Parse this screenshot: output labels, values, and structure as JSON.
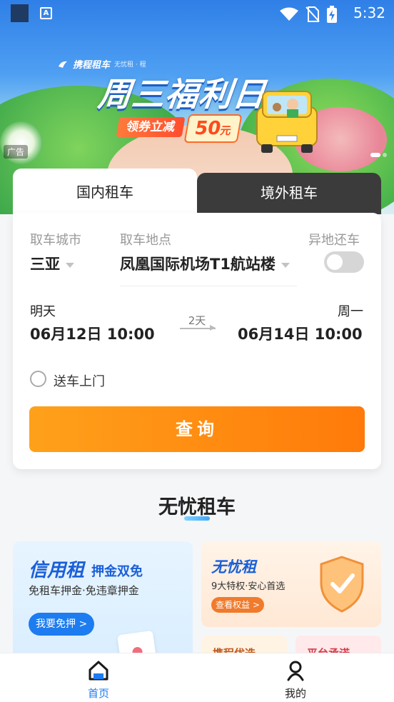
{
  "status_bar": {
    "time": "5:32",
    "icons": [
      "app-square-icon",
      "accessibility-a-icon",
      "wifi-icon",
      "no-sim-icon",
      "battery-charging-icon"
    ],
    "a_glyph": "A"
  },
  "banner": {
    "brand": "携程租车",
    "brand_partner": "无忧租 · 程",
    "title": "周三福利日",
    "ribbon_left": "领券立减",
    "ribbon_amount": "50",
    "ribbon_unit": "元",
    "ad_tag": "广告"
  },
  "tabs": {
    "domestic": "国内租车",
    "overseas": "境外租车"
  },
  "form": {
    "pickup_city_label": "取车城市",
    "pickup_city": "三亚",
    "pickup_location_label": "取车地点",
    "pickup_location": "凤凰国际机场T1航站楼",
    "diff_return_label": "异地还车",
    "diff_return_on": false,
    "start_day": "明天",
    "start_datetime": "06月12日 10:00",
    "duration": "2天",
    "end_day": "周一",
    "end_datetime": "06月14日 10:00",
    "delivery_label": "送车上门",
    "query_label": "查询"
  },
  "section": {
    "title": "无忧租车"
  },
  "promo_left": {
    "title": "信用租",
    "highlight": "押金双免",
    "subtitle": "免租车押金·免违章押金",
    "button": "我要免押 >"
  },
  "promo_right": {
    "title": "无忧租",
    "subtitle": "9大特权·安心首选",
    "button": "查看权益 >"
  },
  "mini_cards": {
    "left": "携程优选",
    "right": "平台承诺"
  },
  "bottom_nav": {
    "home": "首页",
    "mine": "我的"
  },
  "colors": {
    "accent_orange": "#ff8a12",
    "accent_blue": "#1d7cf0",
    "tab_dark": "#3b3b3b"
  }
}
